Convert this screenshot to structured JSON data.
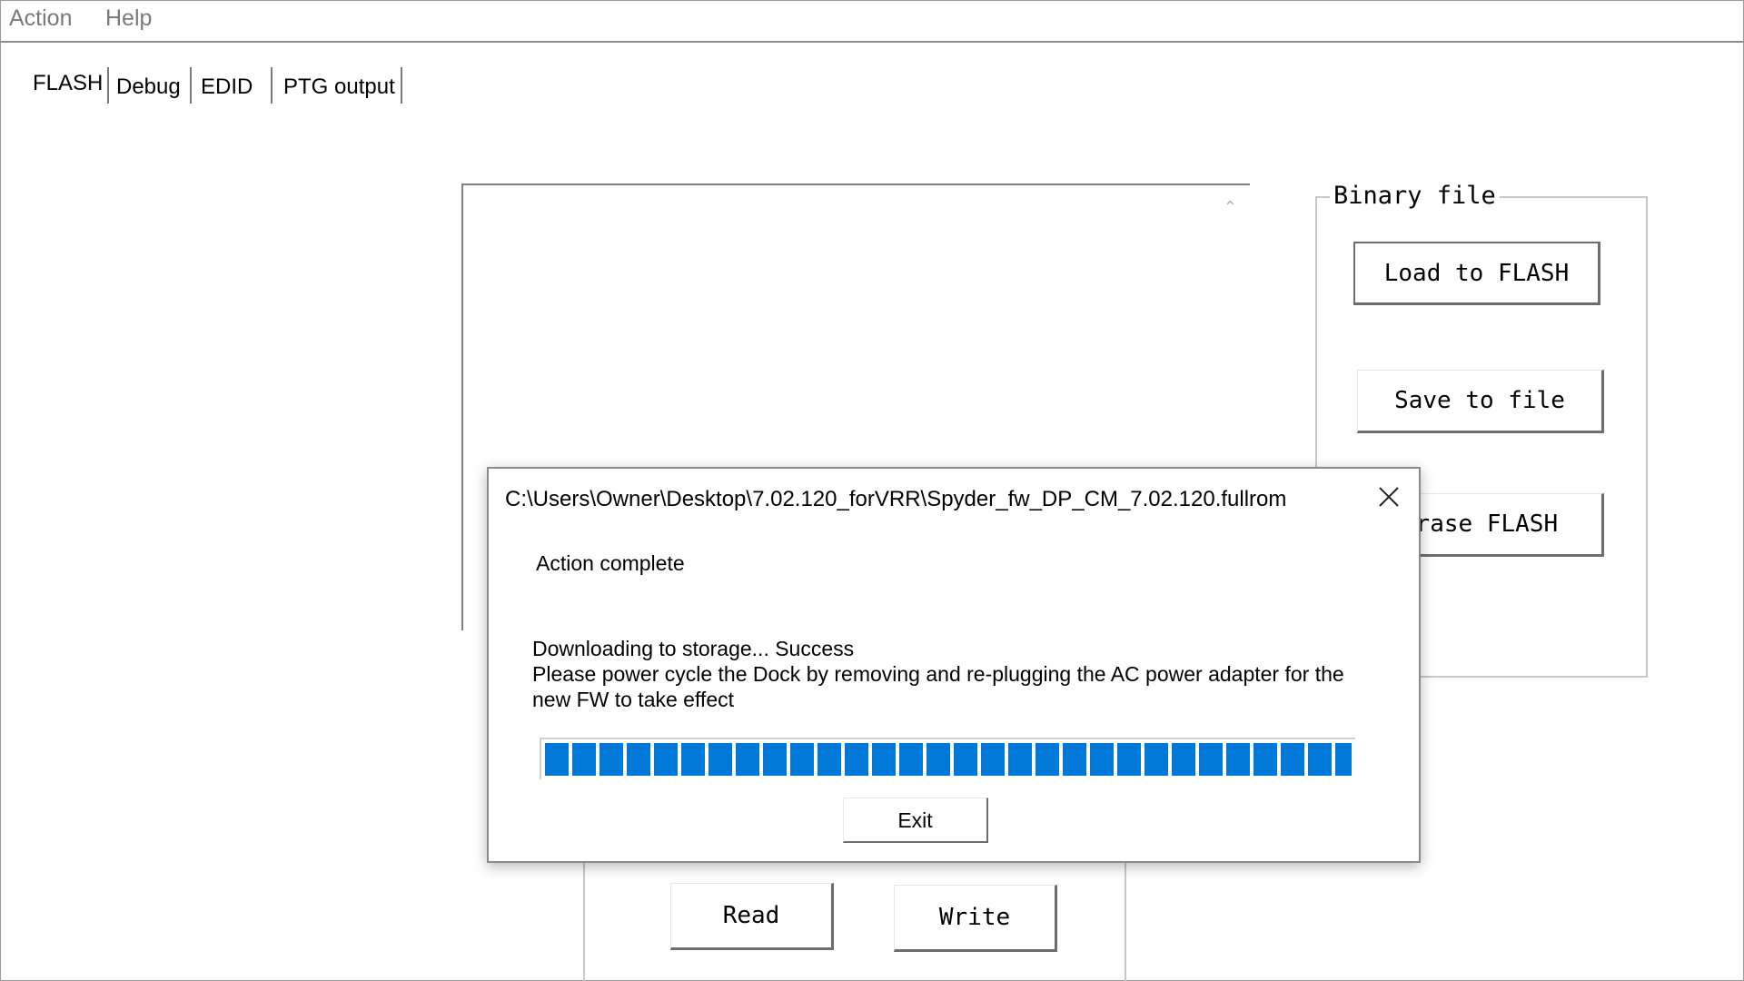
{
  "menu": {
    "items": [
      "Action",
      "Help"
    ]
  },
  "tabs": [
    "FLASH",
    "Debug",
    "EDID",
    "PTG output"
  ],
  "binary_file": {
    "label": "Binary file",
    "load_label": "Load to FLASH",
    "save_label": "Save to file",
    "erase_label": "Erase FLASH"
  },
  "buttons": {
    "read": "Read",
    "write": "Write"
  },
  "dialog": {
    "title": "C:\\Users\\Owner\\Desktop\\7.02.120_forVRR\\Spyder_fw_DP_CM_7.02.120.fullrom",
    "heading": "Action complete",
    "message_line1": "Downloading to storage... Success",
    "message_line2": "Please power cycle the Dock by removing and re-plugging the AC power adapter for the new FW to take effect",
    "progress_percent": 100,
    "exit_label": "Exit"
  },
  "colors": {
    "progress": "#0078d7"
  }
}
